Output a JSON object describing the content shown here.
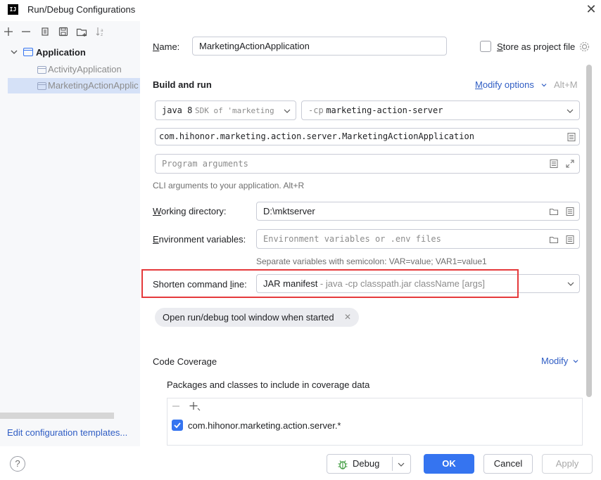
{
  "window": {
    "title": "Run/Debug Configurations",
    "logo": "IJ"
  },
  "sidebar": {
    "toolbar_icons": [
      "add-icon",
      "remove-icon",
      "copy-icon",
      "save-icon",
      "new-folder-icon",
      "sort-icon"
    ],
    "group": "Application",
    "items": [
      "ActivityApplication",
      "MarketingActionApplication"
    ],
    "selected_item": "MarketingActionApplic",
    "edit_templates_link": "Edit configuration templates..."
  },
  "form": {
    "name_label": "Name:",
    "name_value": "MarketingActionApplication",
    "store_label": "Store as project file",
    "build_run_title": "Build and run",
    "modify_options": "Modify options",
    "modify_shortcut": "Alt+M",
    "jdk_prefix": "java 8",
    "jdk_detail": "SDK of 'marketing",
    "module_flag": "-cp",
    "module_value": "marketing-action-server",
    "main_class": "com.hihonor.marketing.action.server.MarketingActionApplication",
    "program_args_placeholder": "Program arguments",
    "cli_hint": "CLI arguments to your application. Alt+R",
    "working_dir_label": "Working directory:",
    "working_dir_value": "D:\\mktserver",
    "env_label": "Environment variables:",
    "env_placeholder": "Environment variables or .env files",
    "env_hint": "Separate variables with semicolon: VAR=value; VAR1=value1",
    "shorten_label": "Shorten command line:",
    "shorten_value": "JAR manifest",
    "shorten_detail": " - java -cp classpath.jar className [args]",
    "chip_label": "Open run/debug tool window when started",
    "coverage_title": "Code Coverage",
    "coverage_modify": "Modify",
    "coverage_packages_label": "Packages and classes to include in coverage data",
    "coverage_entry": "com.hihonor.marketing.action.server.*"
  },
  "footer": {
    "help": "?",
    "debug": "Debug",
    "ok": "OK",
    "cancel": "Cancel",
    "apply": "Apply"
  },
  "colors": {
    "accent": "#3574f0",
    "highlight_box": "#e5393b",
    "selection": "#d5e1f7"
  }
}
